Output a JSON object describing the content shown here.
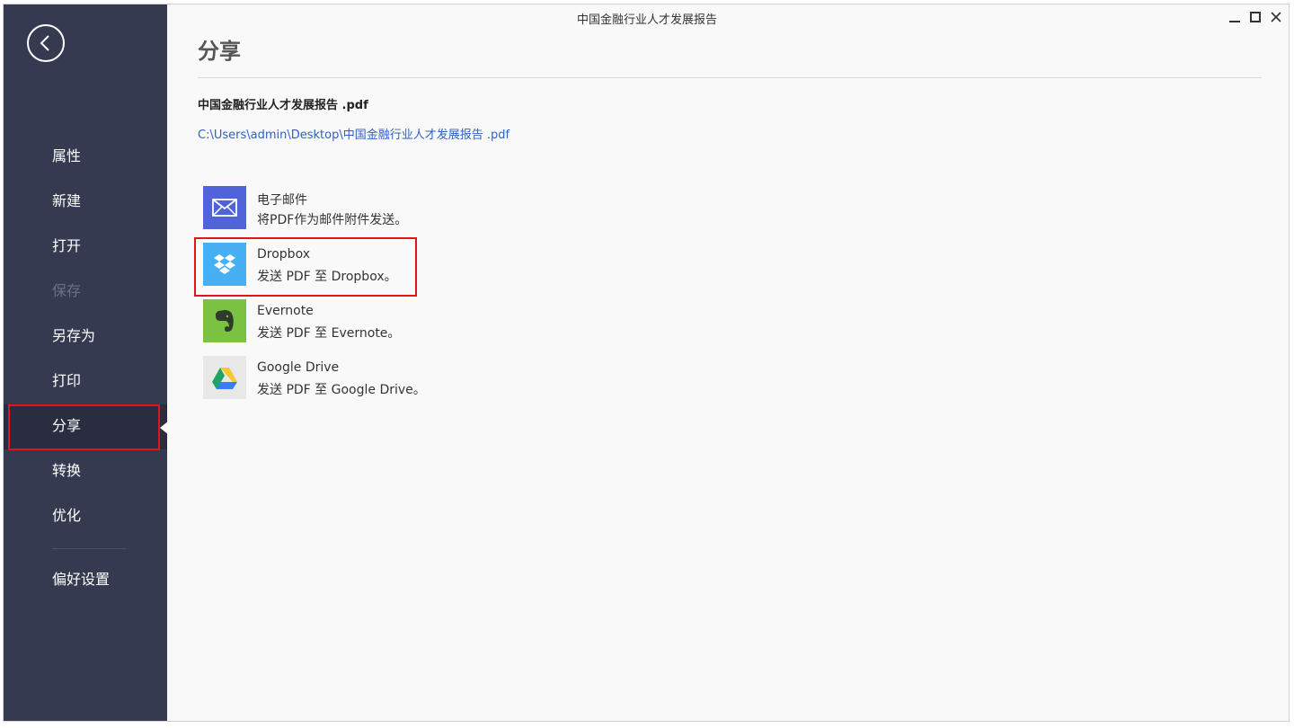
{
  "window": {
    "title": "中国金融行业人才发展报告"
  },
  "sidebar": {
    "items": [
      {
        "label": "属性",
        "state": "normal"
      },
      {
        "label": "新建",
        "state": "normal"
      },
      {
        "label": "打开",
        "state": "normal"
      },
      {
        "label": "保存",
        "state": "disabled"
      },
      {
        "label": "另存为",
        "state": "normal"
      },
      {
        "label": "打印",
        "state": "normal"
      },
      {
        "label": "分享",
        "state": "active"
      },
      {
        "label": "转换",
        "state": "normal"
      },
      {
        "label": "优化",
        "state": "normal"
      }
    ],
    "footer_item": {
      "label": "偏好设置"
    }
  },
  "main": {
    "title": "分享",
    "file_name": "中国金融行业人才发展报告 .pdf",
    "file_path": "C:\\Users\\admin\\Desktop\\中国金融行业人才发展报告 .pdf",
    "share_options": [
      {
        "name": "电子邮件",
        "desc": "将PDF作为邮件附件发送。",
        "icon": "email-icon",
        "color": "#5063d9"
      },
      {
        "name": "Dropbox",
        "desc": "发送 PDF 至 Dropbox。",
        "icon": "dropbox-icon",
        "color": "#47b0f5"
      },
      {
        "name": "Evernote",
        "desc": "发送 PDF 至 Evernote。",
        "icon": "evernote-icon",
        "color": "#7cc242"
      },
      {
        "name": "Google Drive",
        "desc": "发送 PDF 至 Google Drive。",
        "icon": "google-drive-icon",
        "color": "#e8e8e8"
      }
    ]
  },
  "colors": {
    "sidebar_bg": "#363a50",
    "highlight": "#e0141b",
    "link": "#3060c8"
  }
}
